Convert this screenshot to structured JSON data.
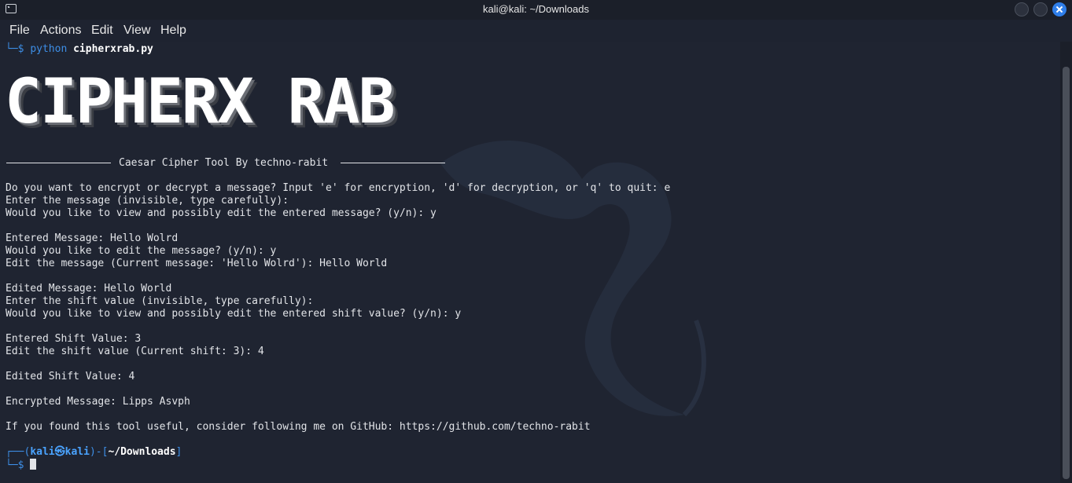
{
  "window": {
    "title": "kali@kali: ~/Downloads"
  },
  "menu": [
    "File",
    "Actions",
    "Edit",
    "View",
    "Help"
  ],
  "terminal": {
    "command_prefix": "└─$ ",
    "command_word": "python",
    "command_arg": "cipherxrab.py",
    "banner": "CIPHERX RAB",
    "subtitle": "Caesar Cipher Tool By techno-rabit",
    "lines": [
      "Do you want to encrypt or decrypt a message? Input 'e' for encryption, 'd' for decryption, or 'q' to quit: e",
      "Enter the message (invisible, type carefully):",
      "Would you like to view and possibly edit the entered message? (y/n): y",
      "",
      "Entered Message: Hello Wolrd",
      "Would you like to edit the message? (y/n): y",
      "Edit the message (Current message: 'Hello Wolrd'): Hello World",
      "",
      "Edited Message: Hello World",
      "Enter the shift value (invisible, type carefully):",
      "Would you like to view and possibly edit the entered shift value? (y/n): y",
      "",
      "Entered Shift Value: 3",
      "Edit the shift value (Current shift: 3): 4",
      "",
      "Edited Shift Value: 4",
      "",
      "Encrypted Message: Lipps Asvph",
      "",
      "If you found this tool useful, consider following me on GitHub: https://github.com/techno-rabit"
    ],
    "prompt": {
      "open": "┌──(",
      "user": "kali",
      "at": "㉿",
      "host": "kali",
      "mid": ")-[",
      "path": "~/Downloads",
      "close": "]",
      "line2": "└─$ "
    }
  },
  "colors": {
    "background": "#1f2431",
    "prompt_blue": "#3d8ee6",
    "text": "#e2e4e8",
    "close_button": "#2f7ee8"
  }
}
